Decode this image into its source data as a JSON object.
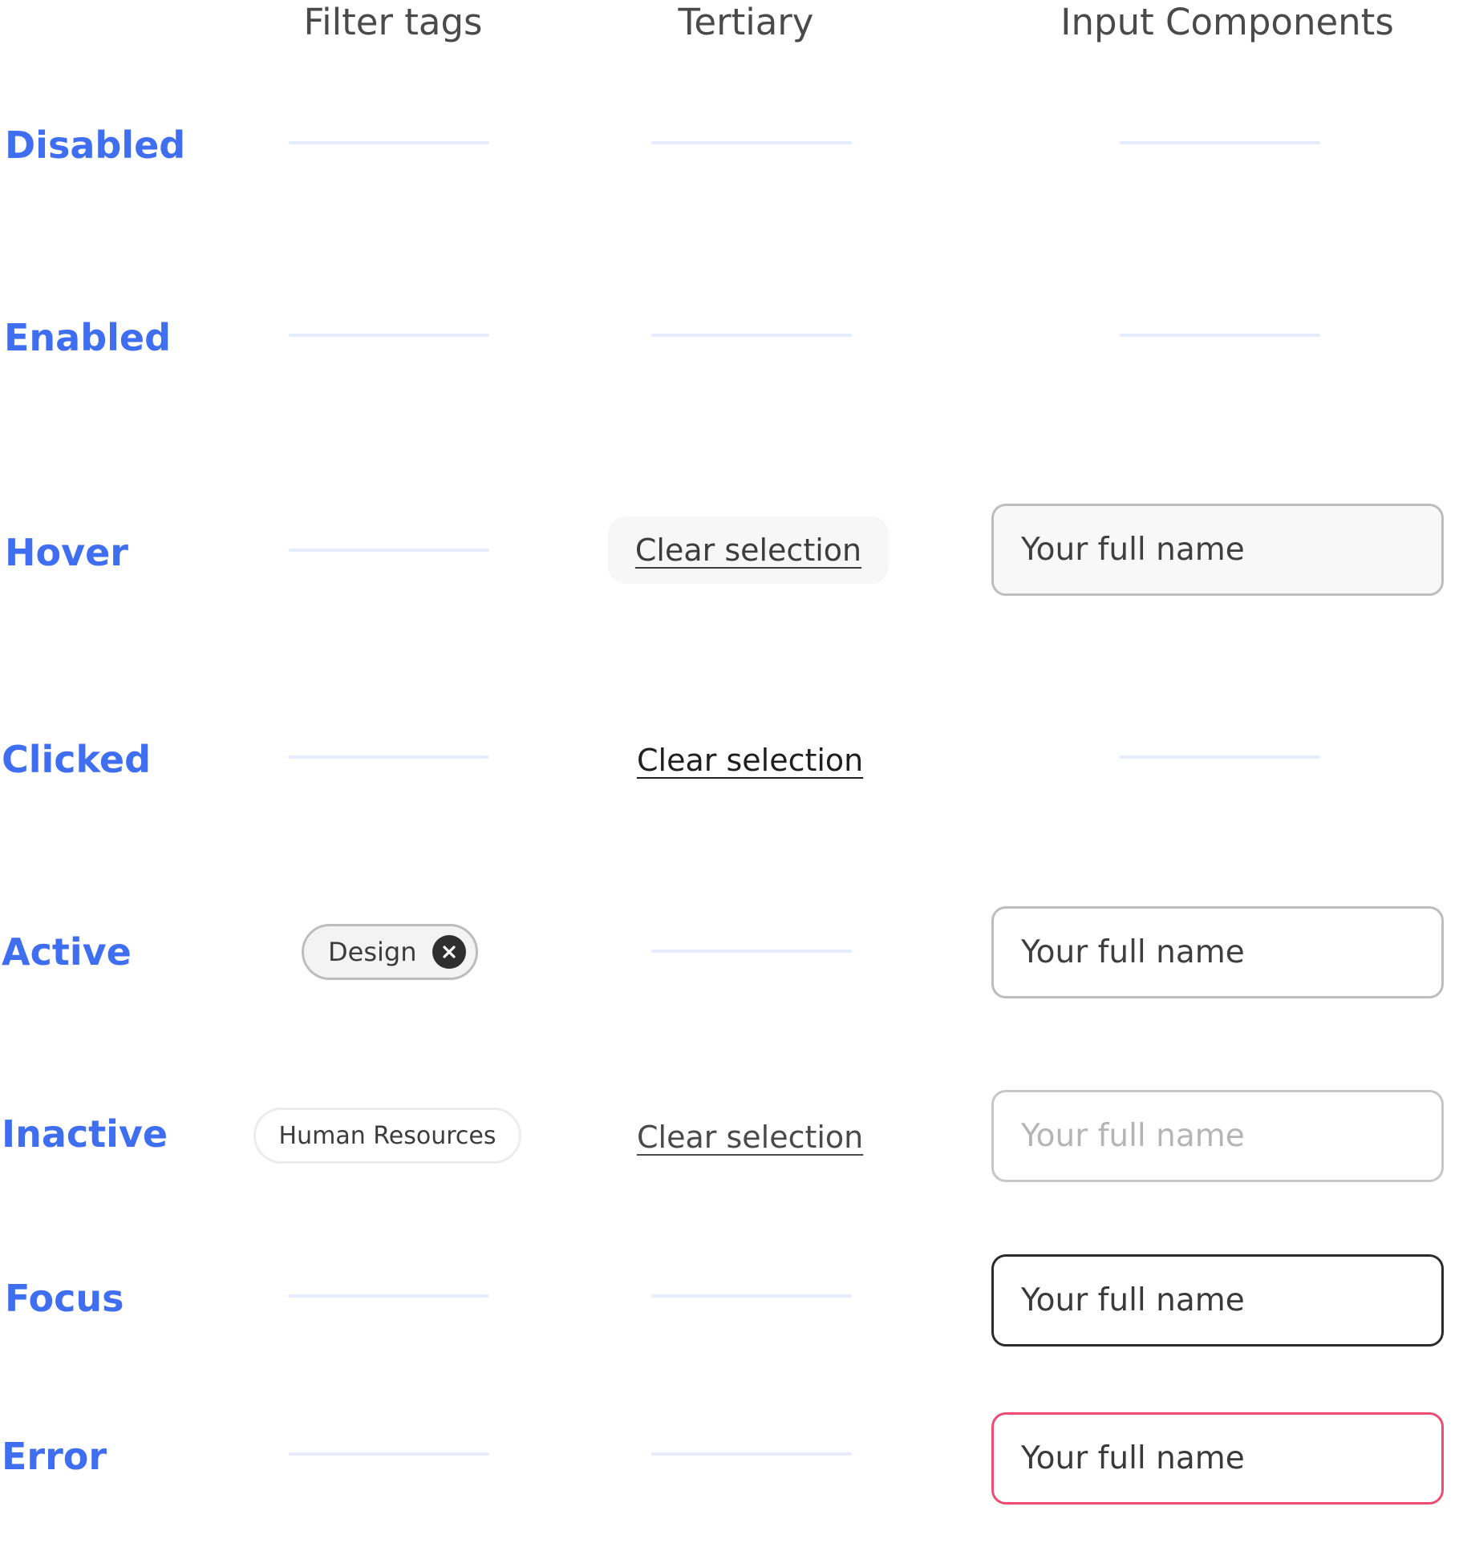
{
  "columns": {
    "filter_tags": "Filter tags",
    "tertiary": "Tertiary",
    "input_components": "Input Components"
  },
  "rows": {
    "disabled": "Disabled",
    "enabled": "Enabled",
    "hover": "Hover",
    "clicked": "Clicked",
    "active": "Active",
    "inactive": "Inactive",
    "focus": "Focus",
    "error": "Error"
  },
  "tertiary": {
    "hover_label": "Clear selection",
    "clicked_label": "Clear selection",
    "inactive_label": "Clear selection"
  },
  "inputs": {
    "hover_value": "Your full name",
    "active_value": "Your full name",
    "inactive_placeholder": "Your full name",
    "focus_value": "Your full name",
    "error_value": "Your full name"
  },
  "filter_tags": {
    "active_tag": "Design",
    "inactive_tag": "Human Resources"
  },
  "colors": {
    "row_label": "#3f6ff0",
    "empty_state_line": "#e6ecfb",
    "error_border": "#ee4d72",
    "focus_border": "#2b2b2b",
    "default_border": "#bdbdbd"
  },
  "icons": {
    "tag_remove": "close-circle-icon"
  }
}
